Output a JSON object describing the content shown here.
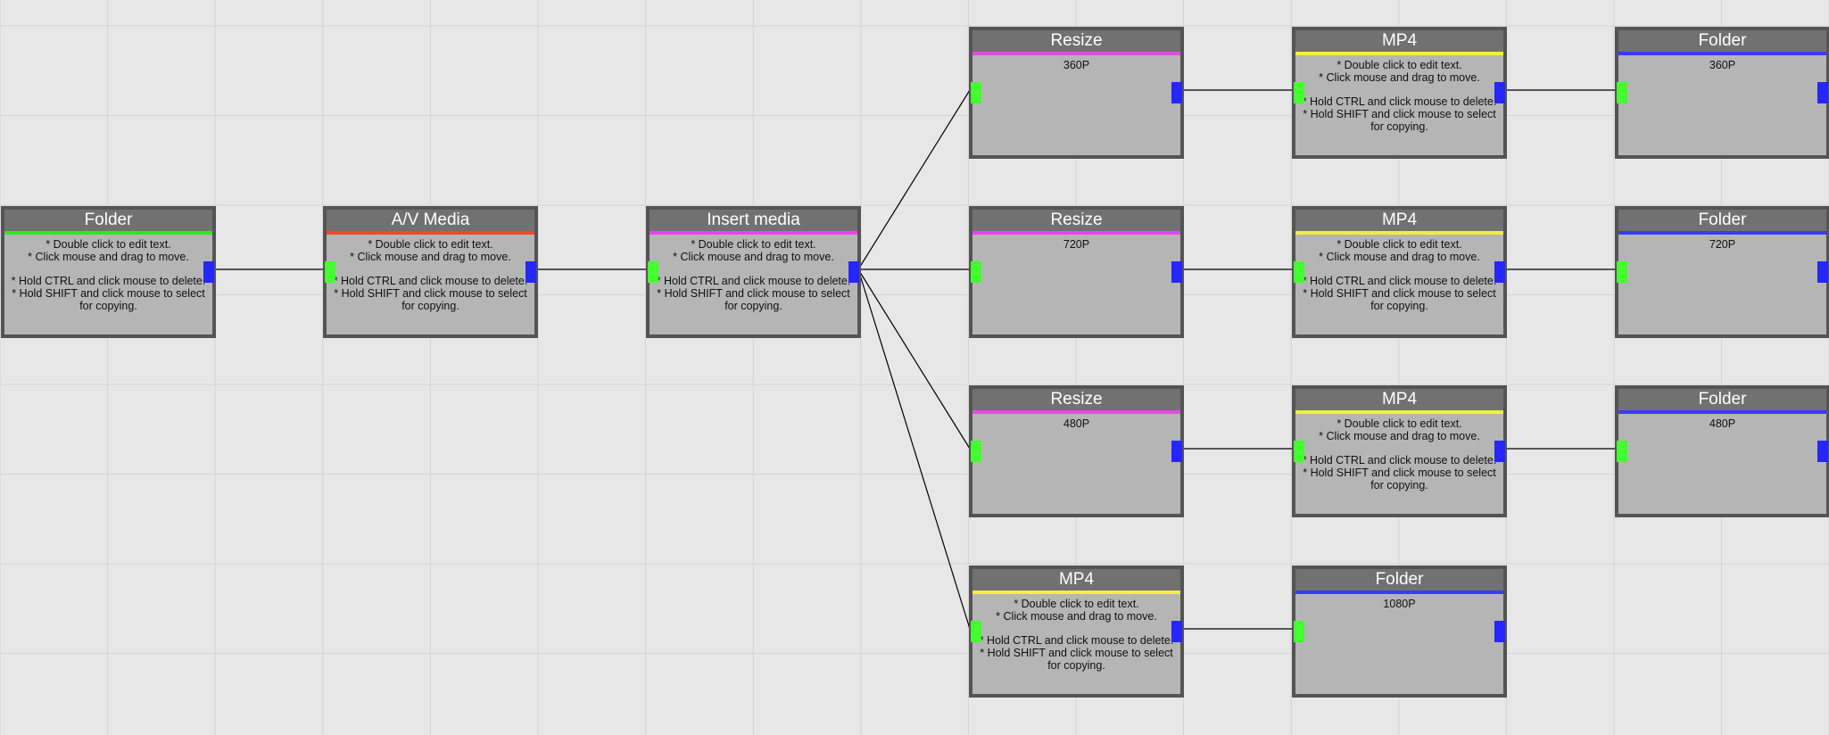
{
  "colors": {
    "folder": "#35e22a",
    "av_media": "#e84a32",
    "insert_media": "#e648e6",
    "resize": "#e648e6",
    "mp4": "#f2ef3c",
    "folder_out": "#3a3aff",
    "input_port": "#43ff30",
    "output_port": "#2626ff"
  },
  "nodes": {
    "folder_src": {
      "title": "Folder",
      "help": [
        "* Double click to edit text.",
        "* Click mouse and drag to move.",
        "* Hold CTRL and click mouse to delete.",
        "* Hold SHIFT and click mouse to select for copying."
      ]
    },
    "av_media": {
      "title": "A/V Media",
      "help": [
        "* Double click to edit text.",
        "* Click mouse and drag to move.",
        "* Hold CTRL and click mouse to delete.",
        "* Hold SHIFT and click mouse to select for copying."
      ]
    },
    "insert_media": {
      "title": "Insert media",
      "help": [
        "* Double click to edit text.",
        "* Click mouse and drag to move.",
        "* Hold CTRL and click mouse to delete.",
        "* Hold SHIFT and click mouse to select for copying."
      ]
    },
    "resize_360": {
      "title": "Resize",
      "value": "360P"
    },
    "mp4_360": {
      "title": "MP4",
      "help": [
        "* Double click to edit text.",
        "* Click mouse and drag to move.",
        "* Hold CTRL and click mouse to delete.",
        "* Hold SHIFT and click mouse to select for copying."
      ]
    },
    "folder_360": {
      "title": "Folder",
      "value": "360P"
    },
    "resize_720": {
      "title": "Resize",
      "value": "720P"
    },
    "mp4_720": {
      "title": "MP4",
      "help": [
        "* Double click to edit text.",
        "* Click mouse and drag to move.",
        "* Hold CTRL and click mouse to delete.",
        "* Hold SHIFT and click mouse to select for copying."
      ]
    },
    "folder_720": {
      "title": "Folder",
      "value": "720P"
    },
    "resize_480": {
      "title": "Resize",
      "value": "480P"
    },
    "mp4_480": {
      "title": "MP4",
      "help": [
        "* Double click to edit text.",
        "* Click mouse and drag to move.",
        "* Hold CTRL and click mouse to delete.",
        "* Hold SHIFT and click mouse to select for copying."
      ]
    },
    "folder_480": {
      "title": "Folder",
      "value": "480P"
    },
    "mp4_1080": {
      "title": "MP4",
      "help": [
        "* Double click to edit text.",
        "* Click mouse and drag to move.",
        "* Hold CTRL and click mouse to delete.",
        "* Hold SHIFT and click mouse to select for copying."
      ]
    },
    "folder_1080": {
      "title": "Folder",
      "value": "1080P"
    }
  }
}
